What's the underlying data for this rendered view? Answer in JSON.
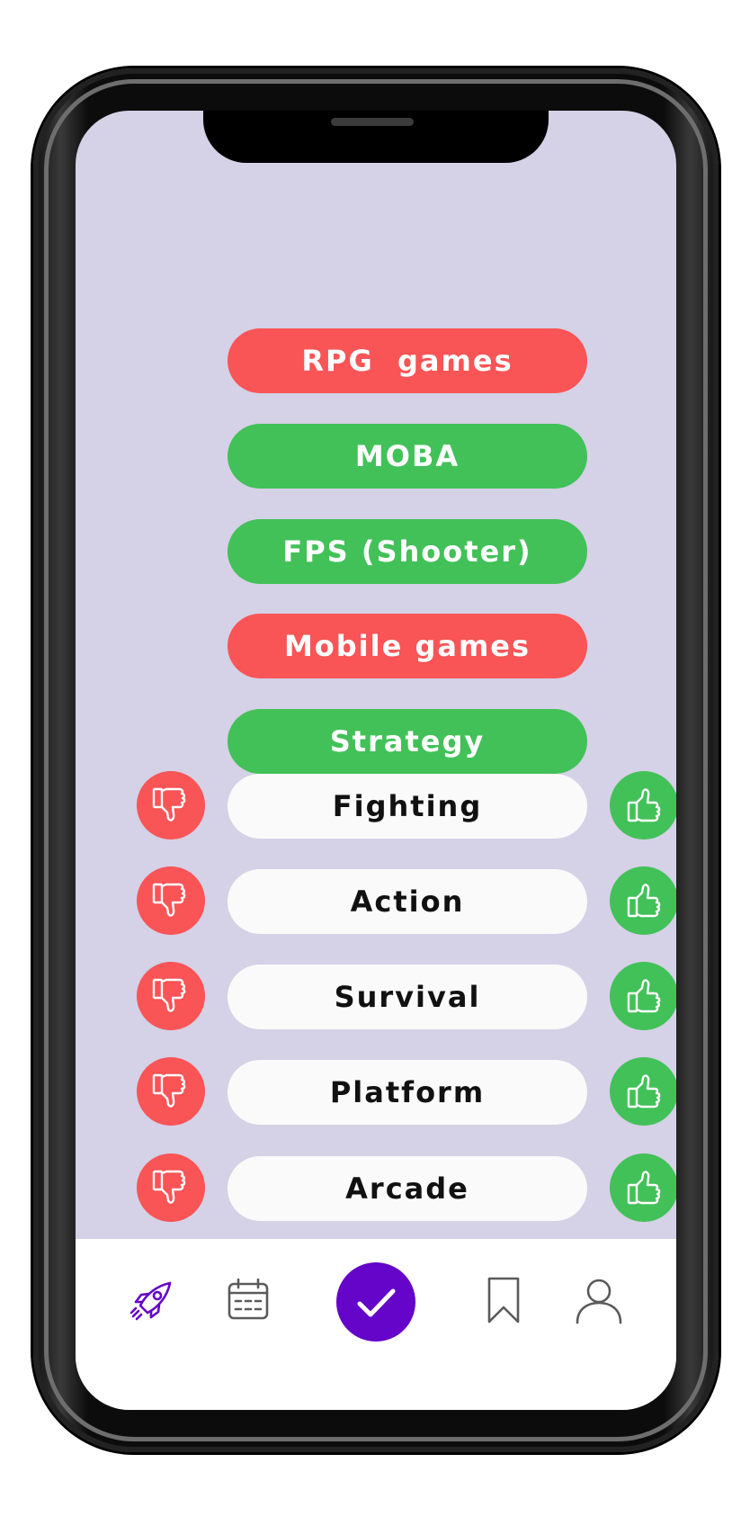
{
  "colors": {
    "screen_bg": "#d5d1e6",
    "dislike": "#f95456",
    "like": "#42c158",
    "neutral": "#fafafa",
    "accent": "#6505c9",
    "nav_icon": "#5a5a5a"
  },
  "rated_genres": [
    {
      "label": "RPG  games",
      "status": "disliked"
    },
    {
      "label": "MOBA",
      "status": "liked"
    },
    {
      "label": "FPS (Shooter)",
      "status": "liked"
    },
    {
      "label": "Mobile games",
      "status": "disliked"
    },
    {
      "label": "Strategy",
      "status": "liked"
    }
  ],
  "unrated_genres": [
    {
      "label": "Fighting",
      "dislike_icon": "thumbs-down-icon",
      "like_icon": "thumbs-up-icon"
    },
    {
      "label": "Action",
      "dislike_icon": "thumbs-down-icon",
      "like_icon": "thumbs-up-icon"
    },
    {
      "label": "Survival",
      "dislike_icon": "thumbs-down-icon",
      "like_icon": "thumbs-up-icon"
    },
    {
      "label": "Platform",
      "dislike_icon": "thumbs-down-icon",
      "like_icon": "thumbs-up-icon"
    },
    {
      "label": "Arcade",
      "dislike_icon": "thumbs-down-icon",
      "like_icon": "thumbs-up-icon"
    }
  ],
  "nav": {
    "items": [
      {
        "icon": "rocket-icon",
        "active": true
      },
      {
        "icon": "calendar-icon",
        "active": false
      },
      {
        "icon": "checkmark-icon",
        "active": false,
        "primary": true
      },
      {
        "icon": "bookmark-icon",
        "active": false
      },
      {
        "icon": "user-icon",
        "active": false
      }
    ]
  }
}
